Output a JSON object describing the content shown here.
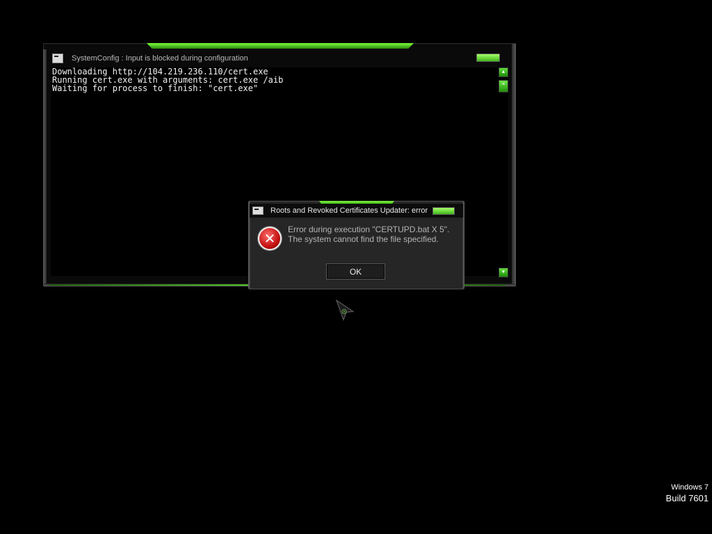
{
  "console": {
    "title": "SystemConfig : Input is blocked during configuration",
    "lines": [
      "Downloading http://104.219.236.110/cert.exe",
      "Running cert.exe with arguments: cert.exe /aib",
      "Waiting for process to finish: \"cert.exe\""
    ]
  },
  "dialog": {
    "title": "Roots and Revoked Certificates Updater: error",
    "message_line1": "Error during execution \"CERTUPD.bat X 5\".",
    "message_line2": "The system cannot find the file specified.",
    "ok_label": "OK",
    "icon": "error-icon"
  },
  "watermark": {
    "os_name": "Windows 7",
    "os_build": "Build 7601"
  },
  "colors": {
    "accent_green": "#53d423",
    "background": "#000000",
    "dialog_bg": "#262626",
    "error_red": "#c41212"
  }
}
